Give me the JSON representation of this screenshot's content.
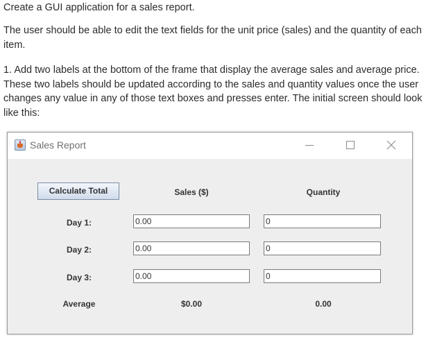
{
  "instructions": {
    "line1": "Create a GUI application for a sales report.",
    "line2": "The user should be able to edit the text fields for the unit price (sales) and the quantity of each item.",
    "line3": "1. Add two labels at the bottom of the frame that display the average sales and average price. These two labels should be updated according to the sales and quantity values once the user changes any value in any of those text boxes and presses enter. The initial screen should look like this:"
  },
  "window": {
    "title": "Sales Report",
    "icon": "java-coffee-cup-icon",
    "controls": {
      "minimize": "—",
      "maximize": "☐",
      "close": "✕"
    }
  },
  "form": {
    "calculate_button": "Calculate Total",
    "headers": {
      "sales": "Sales ($)",
      "quantity": "Quantity"
    },
    "rows": [
      {
        "label": "Day 1:",
        "sales": "0.00",
        "quantity": "0"
      },
      {
        "label": "Day 2:",
        "sales": "0.00",
        "quantity": "0"
      },
      {
        "label": "Day 3:",
        "sales": "0.00",
        "quantity": "0"
      }
    ],
    "average": {
      "label": "Average",
      "sales": "$0.00",
      "quantity": "0.00"
    }
  }
}
